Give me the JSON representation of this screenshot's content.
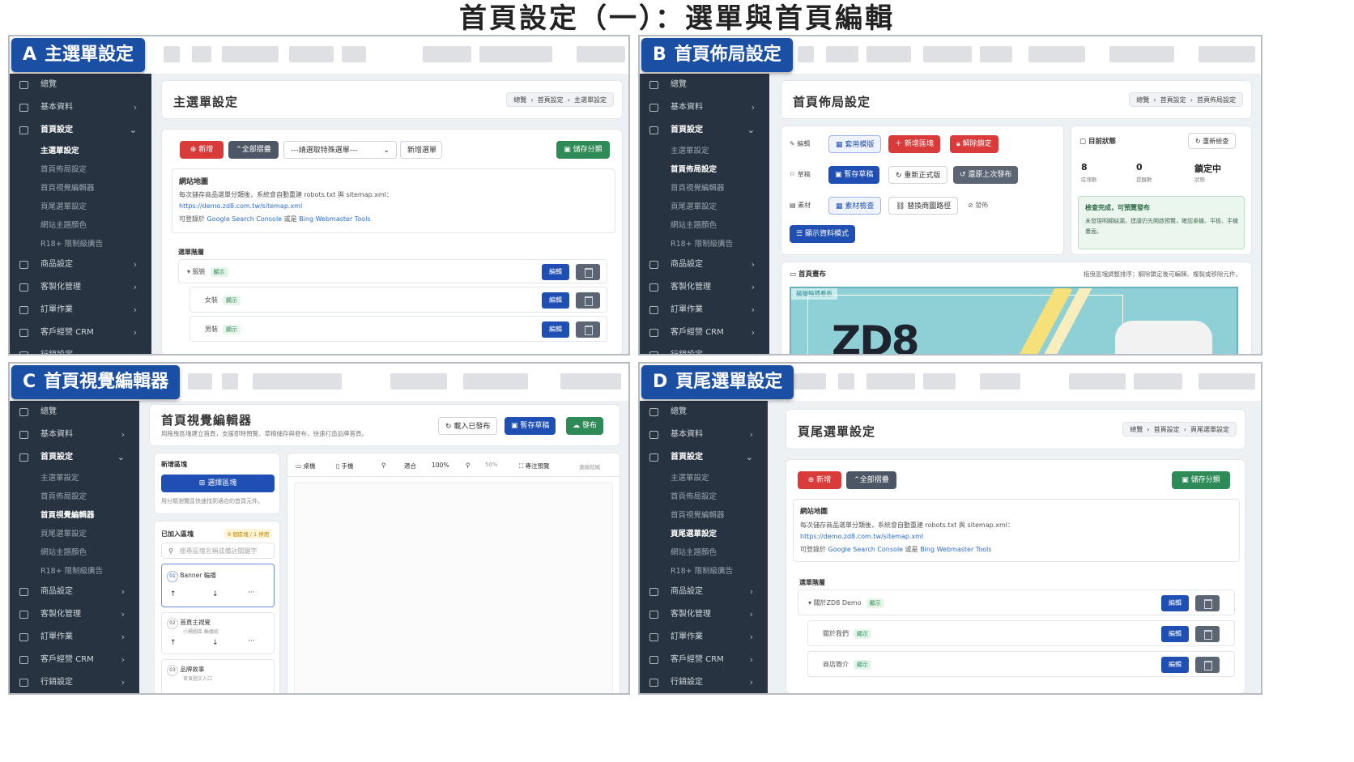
{
  "page_title": "首頁設定（一）：選單與首頁編輯",
  "sidebar": {
    "overview": "總覽",
    "basic": "基本資料",
    "home": "首頁設定",
    "sub": [
      "主選單設定",
      "首頁佈局設定",
      "首頁視覺編輯器",
      "頁尾選單設定",
      "網站主題顏色",
      "R18+ 限制級廣告"
    ],
    "product": "商品設定",
    "custom": "客製化管理",
    "orders": "訂單作業",
    "crm": "客戶經營 CRM",
    "marketing": "行銷設定"
  },
  "breadcrumb": {
    "overview": "總覽",
    "home": "首頁設定"
  },
  "sitemap": {
    "title": "網站地圖",
    "desc": "每次儲存商品選單分類後，系統會自動重建 robots.txt 與 sitemap.xml：",
    "url": "https://demo.zd8.com.tw/sitemap.xml",
    "submit_prefix": "可登錄於",
    "gsc": "Google Search Console",
    "or": "或是",
    "bing": "Bing Webmaster Tools"
  },
  "common": {
    "add": "新增",
    "collapse_all": "全部摺疊",
    "save_category": "儲存分類",
    "menu_tree": "選單階層",
    "visible": "顯示",
    "edit": "編輯"
  },
  "panel_a": {
    "letter": "A",
    "label": "主選單設定",
    "title": "主選單設定",
    "crumb_current": "主選單設定",
    "select_placeholder": "---請選取特殊選單---",
    "add_menu": "新增選單",
    "items": [
      "服裝",
      "女裝",
      "男裝"
    ]
  },
  "panel_b": {
    "letter": "B",
    "label": "首頁佈局設定",
    "title": "首頁佈局設定",
    "crumb_current": "首頁佈局設定",
    "row1_label": "編輯",
    "apply_template": "套用模版",
    "add_block": "新增區塊",
    "unlock": "解除鎖定",
    "row2_label": "草稿",
    "save_draft": "暫存草稿",
    "reset_official": "重新正式版",
    "restore_last": "還原上次發布",
    "row3_label": "素材",
    "asset_check": "素材檢查",
    "replace_path": "替換商圖路徑",
    "publish": "發佈",
    "show_data_mode": "顯示資料模式",
    "status_title": "目前狀態",
    "recheck": "重新檢查",
    "stat1_value": "8",
    "stat1_label": "區塊數",
    "stat2_value": "0",
    "stat2_label": "提醒數",
    "stat3_value": "鎖定中",
    "stat3_label": "狀態",
    "check_title": "檢查完成，可預覽發布",
    "check_desc": "未發現明顯缺漏，建議仍先開啟預覽，確認桌機、平板、手機畫面。",
    "canvas_title": "首頁畫布",
    "canvas_hint": "拖曳區塊調整排序；解除鎖定後可編輯、複製或移除元件。",
    "banner_tag": "橫幅輪播看板",
    "banner_text": "ZD8"
  },
  "panel_c": {
    "letter": "C",
    "label": "首頁視覺編輯器",
    "title": "首頁視覺編輯器",
    "subtitle": "用拖曳區塊建立首頁，支援即時預覽、草稿儲存與發布，快速打造品牌首頁。",
    "load_published": "載入已發布",
    "save_draft": "暫存草稿",
    "publish": "發布",
    "add_block_title": "新增區塊",
    "choose_block": "選擇區塊",
    "add_hint": "用分類瀏覽區快速找到適合的首頁元件。",
    "desktop": "桌機",
    "mobile": "手機",
    "fit": "適合",
    "zoom": "100%",
    "zoom2": "50%",
    "focus_preview": "專注預覽",
    "connected": "連線就緒",
    "added_title": "已加入區塊",
    "added_badge": "9 個區塊 / 1 停用",
    "search_placeholder": "搜尋區塊名稱或備註關鍵字",
    "blocks": [
      {
        "no": "01",
        "name": "Banner 輪播",
        "sub": ""
      },
      {
        "no": "02",
        "name": "首頁主視覺",
        "sub": "小標圖區 輪播組"
      },
      {
        "no": "03",
        "name": "品牌故事",
        "sub": "首頁圖文入口"
      }
    ]
  },
  "panel_d": {
    "letter": "D",
    "label": "頁尾選單設定",
    "title": "頁尾選單設定",
    "crumb_current": "頁尾選單設定",
    "items": [
      "關於ZD8 Demo",
      "關於我們",
      "商店簡介"
    ]
  }
}
